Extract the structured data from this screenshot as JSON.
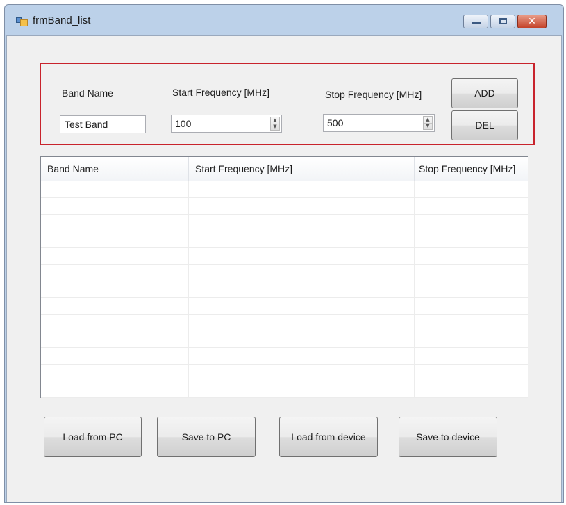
{
  "window": {
    "title": "frmBand_list",
    "icon": "form-icon",
    "controls": [
      "minimize",
      "maximize",
      "close"
    ],
    "close_glyph": "✕"
  },
  "input_group": {
    "band_name_label": "Band Name",
    "band_name_value": "Test Band",
    "start_freq_label": "Start Frequency [MHz]",
    "start_freq_value": "100",
    "stop_freq_label": "Stop Frequency [MHz]",
    "stop_freq_value": "500",
    "add_label": "ADD",
    "del_label": "DEL",
    "highlight_color": "#c8232c"
  },
  "table": {
    "columns": [
      "Band Name",
      "Start Frequency [MHz]",
      "Stop Frequency [MHz]"
    ],
    "rows": []
  },
  "actions": {
    "load_pc": "Load from PC",
    "save_pc": "Save to PC",
    "load_device": "Load from device",
    "save_device": "Save to device"
  }
}
